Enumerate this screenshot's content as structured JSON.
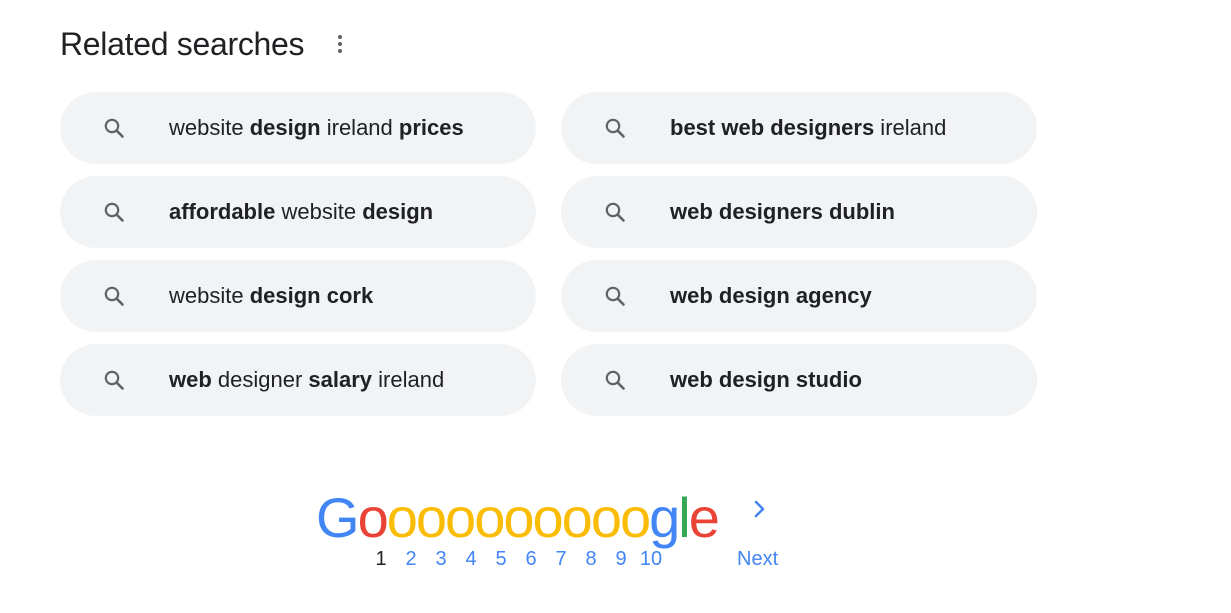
{
  "related": {
    "title": "Related searches",
    "items": [
      {
        "segments": [
          {
            "t": "website ",
            "b": false
          },
          {
            "t": "design",
            "b": true
          },
          {
            "t": " ireland ",
            "b": false
          },
          {
            "t": "prices",
            "b": true
          }
        ]
      },
      {
        "segments": [
          {
            "t": "best web designers",
            "b": true
          },
          {
            "t": " ireland",
            "b": false
          }
        ]
      },
      {
        "segments": [
          {
            "t": "affordable",
            "b": true
          },
          {
            "t": " website ",
            "b": false
          },
          {
            "t": "design",
            "b": true
          }
        ]
      },
      {
        "segments": [
          {
            "t": "web designers dublin",
            "b": true
          }
        ]
      },
      {
        "segments": [
          {
            "t": "website ",
            "b": false
          },
          {
            "t": "design cork",
            "b": true
          }
        ]
      },
      {
        "segments": [
          {
            "t": "web design agency",
            "b": true
          }
        ]
      },
      {
        "segments": [
          {
            "t": "web",
            "b": true
          },
          {
            "t": " designer ",
            "b": false
          },
          {
            "t": "salary",
            "b": true
          },
          {
            "t": " ireland",
            "b": false
          }
        ]
      },
      {
        "segments": [
          {
            "t": "web design studio",
            "b": true
          }
        ]
      }
    ]
  },
  "pagination": {
    "logo": [
      {
        "ch": "G",
        "color": "#4285f4"
      },
      {
        "ch": "o",
        "color": "#ea4335"
      },
      {
        "ch": "o",
        "color": "#fbbc05"
      },
      {
        "ch": "o",
        "color": "#fbbc05"
      },
      {
        "ch": "o",
        "color": "#fbbc05"
      },
      {
        "ch": "o",
        "color": "#fbbc05"
      },
      {
        "ch": "o",
        "color": "#fbbc05"
      },
      {
        "ch": "o",
        "color": "#fbbc05"
      },
      {
        "ch": "o",
        "color": "#fbbc05"
      },
      {
        "ch": "o",
        "color": "#fbbc05"
      },
      {
        "ch": "o",
        "color": "#fbbc05"
      },
      {
        "ch": "g",
        "color": "#4285f4"
      },
      {
        "ch": "l",
        "color": "#34a853"
      },
      {
        "ch": "e",
        "color": "#ea4335"
      }
    ],
    "pages": [
      "1",
      "2",
      "3",
      "4",
      "5",
      "6",
      "7",
      "8",
      "9",
      "10"
    ],
    "current_page": "1",
    "next_label": "Next"
  },
  "colors": {
    "chip_bg": "#f1f3f4",
    "link": "#4285f4",
    "text": "#202124",
    "icon": "#5f6368"
  },
  "icons": {
    "chip": "search-icon",
    "more": "more-vert-icon",
    "next": "chevron-right-icon"
  }
}
